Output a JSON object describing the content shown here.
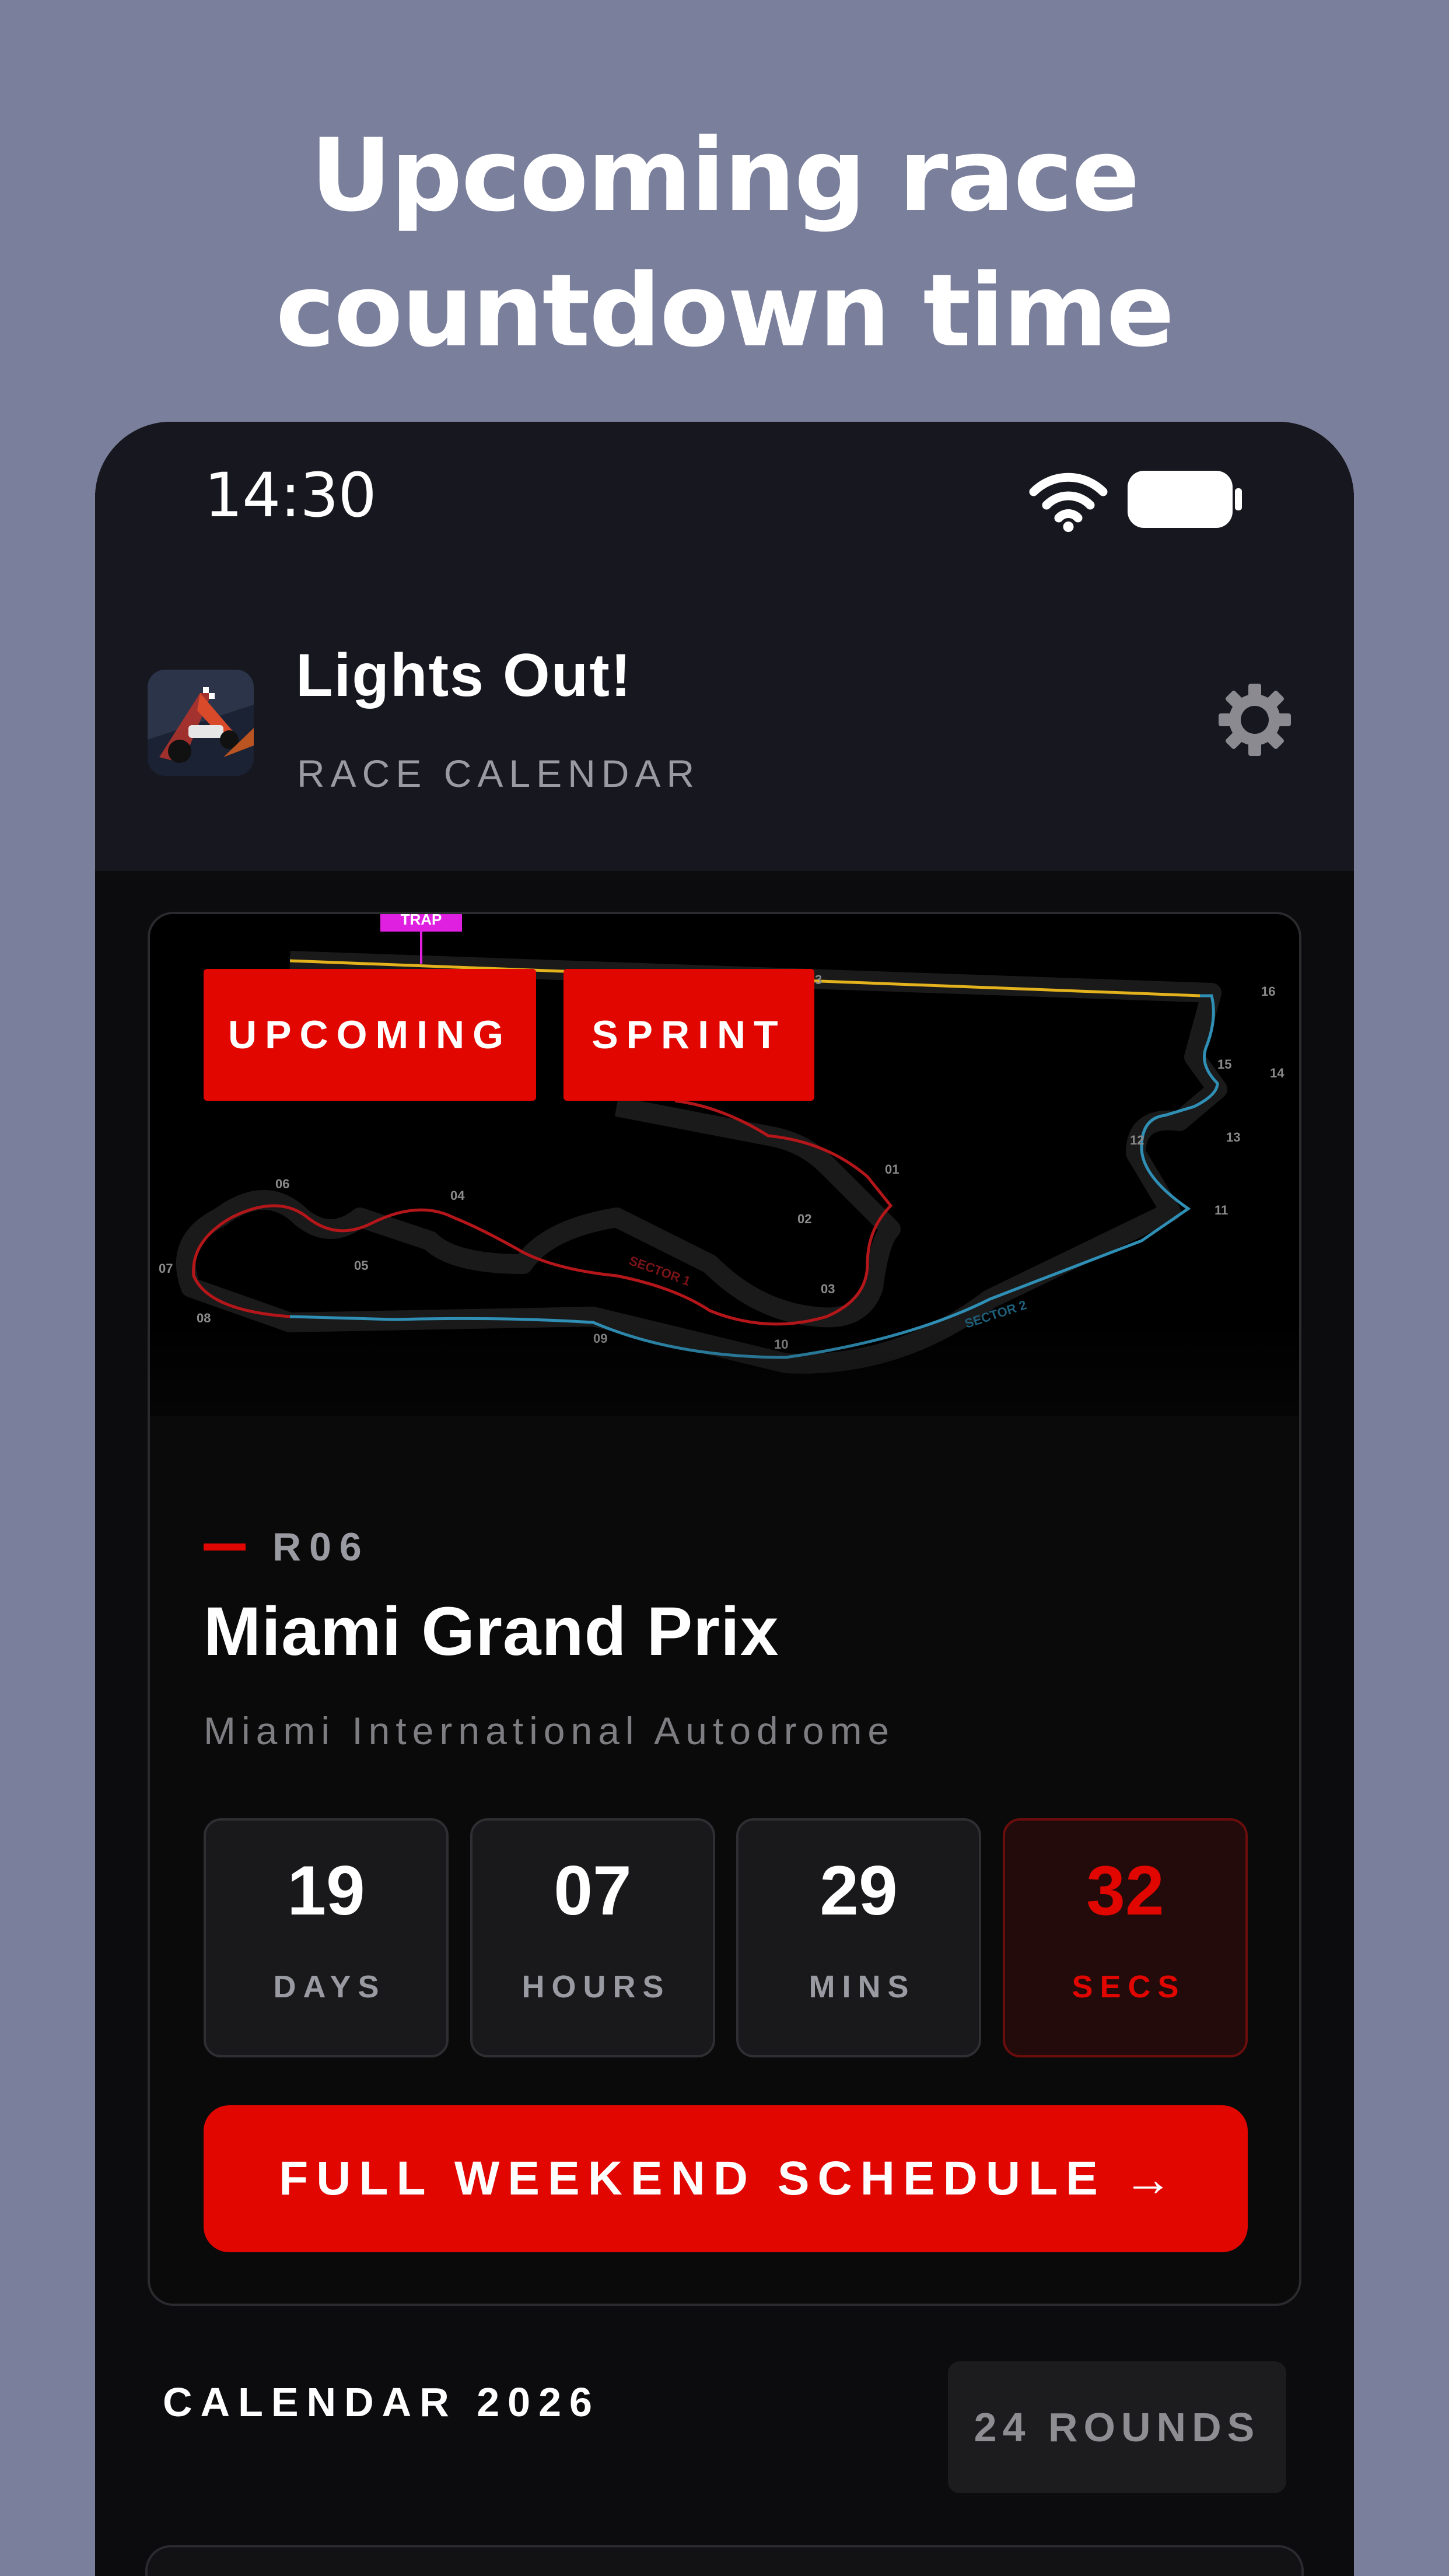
{
  "headline": {
    "line1": "Upcoming race",
    "line2": "countdown time"
  },
  "status_bar": {
    "time": "14:30"
  },
  "header": {
    "title": "Lights Out!",
    "subtitle": "RACE CALENDAR"
  },
  "featured_race": {
    "badges": [
      "UPCOMING",
      "SPRINT"
    ],
    "round": "R06",
    "name": "Miami Grand Prix",
    "circuit": "Miami International Autodrome",
    "map_labels": {
      "trap": "TRAP",
      "sector1": "SECTOR 1",
      "sector2": "SECTOR 2",
      "turns": [
        "01",
        "02",
        "03",
        "04",
        "05",
        "06",
        "07",
        "08",
        "09",
        "10",
        "11",
        "12",
        "13",
        "14",
        "15",
        "16",
        "3"
      ]
    },
    "countdown": [
      {
        "value": "19",
        "unit": "DAYS"
      },
      {
        "value": "07",
        "unit": "HOURS"
      },
      {
        "value": "29",
        "unit": "MINS"
      },
      {
        "value": "32",
        "unit": "SECS"
      }
    ],
    "schedule_button": "FULL WEEKEND SCHEDULE",
    "schedule_arrow": "→"
  },
  "calendar": {
    "title": "CALENDAR 2026",
    "rounds": "24 ROUNDS"
  },
  "colors": {
    "accent": "#e10600",
    "background": "#7a7f9c",
    "surface": "#0c0c0e",
    "header": "#17171f"
  }
}
